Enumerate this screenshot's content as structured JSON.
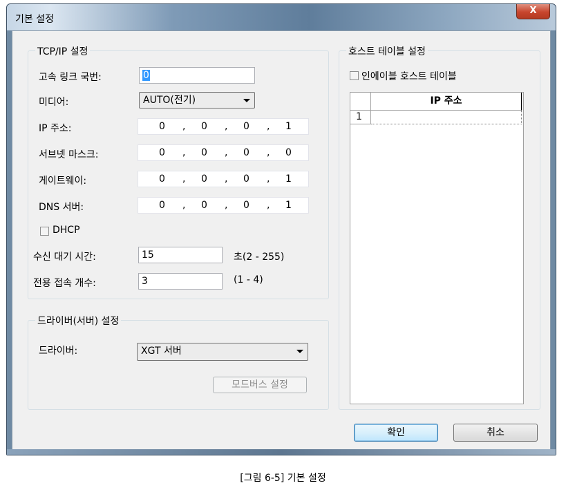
{
  "window": {
    "title": "기본 설정",
    "close_label": "X"
  },
  "tcpip": {
    "title": "TCP/IP 설정",
    "link_label": "고속 링크 국번:",
    "link_value": "0",
    "media_label": "미디어:",
    "media_value": "AUTO(전기)",
    "ip_label": "IP 주소:",
    "ip": [
      "0",
      "0",
      "0",
      "1"
    ],
    "subnet_label": "서브넷 마스크:",
    "subnet": [
      "0",
      "0",
      "0",
      "0"
    ],
    "gateway_label": "게이트웨이:",
    "gateway": [
      "0",
      "0",
      "0",
      "1"
    ],
    "dns_label": "DNS 서버:",
    "dns": [
      "0",
      "0",
      "0",
      "1"
    ],
    "dhcp_label": "DHCP",
    "timeout_label": "수신 대기 시간:",
    "timeout_value": "15",
    "timeout_unit": "초(2 - 255)",
    "conn_label": "전용 접속 개수:",
    "conn_value": "3",
    "conn_range": "(1 - 4)"
  },
  "driver": {
    "title": "드라이버(서버) 설정",
    "label": "드라이버:",
    "value": "XGT 서버",
    "modbus_button": "모드버스 설정"
  },
  "host": {
    "title": "호스트 테이블 설정",
    "enable_label": "인에이블 호스트 테이블",
    "column_header": "IP 주소",
    "rows": [
      {
        "num": "1",
        "ip": ""
      }
    ]
  },
  "buttons": {
    "ok": "확인",
    "cancel": "취소"
  },
  "caption": "[그림 6-5] 기본 설정"
}
